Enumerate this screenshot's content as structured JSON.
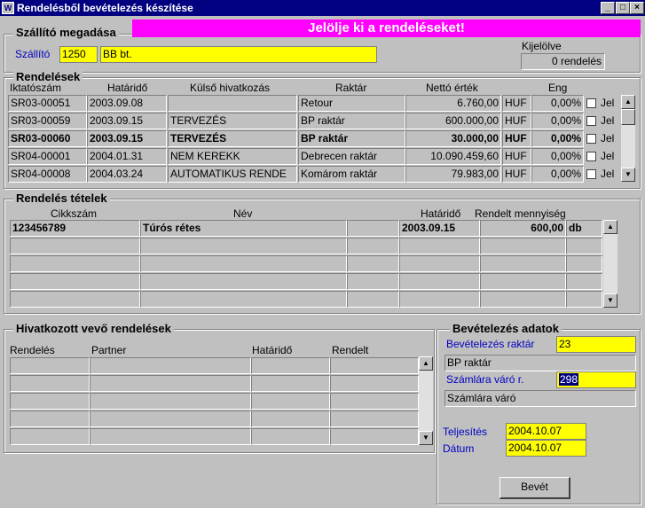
{
  "window": {
    "title": "Rendelésből bevételezés készítése",
    "minimize_glyph": "_",
    "restore_glyph": "□",
    "close_glyph": "×"
  },
  "banner": "Jelölje ki a rendeléseket!",
  "supplier": {
    "group_title": "Szállító megadása",
    "label": "Szállító",
    "code": "1250",
    "name": "BB bt.",
    "selected_label": "Kijelölve",
    "selected_value": "0 rendelés"
  },
  "orders": {
    "group_title": "Rendelések",
    "headers": [
      "Iktatószám",
      "Határidő",
      "Külső hivatkozás",
      "Raktár",
      "Nettó érték",
      "Eng"
    ],
    "rows": [
      {
        "id": "SR03-00051",
        "date": "2003.09.08",
        "ref": "",
        "warehouse": "Retour",
        "net": "6.760,00",
        "cur": "HUF",
        "disc": "0,00%",
        "jel": "Jel",
        "bold": false
      },
      {
        "id": "SR03-00059",
        "date": "2003.09.15",
        "ref": "TERVEZÉS",
        "warehouse": "BP raktár",
        "net": "600.000,00",
        "cur": "HUF",
        "disc": "0,00%",
        "jel": "Jel",
        "bold": false
      },
      {
        "id": "SR03-00060",
        "date": "2003.09.15",
        "ref": "TERVEZÉS",
        "warehouse": "BP raktár",
        "net": "30.000,00",
        "cur": "HUF",
        "disc": "0,00%",
        "jel": "Jel",
        "bold": true
      },
      {
        "id": "SR04-00001",
        "date": "2004.01.31",
        "ref": "NEM KEREKK",
        "warehouse": "Debrecen raktár",
        "net": "10.090.459,60",
        "cur": "HUF",
        "disc": "0,00%",
        "jel": "Jel",
        "bold": false
      },
      {
        "id": "SR04-00008",
        "date": "2004.03.24",
        "ref": "AUTOMATIKUS RENDE",
        "warehouse": "Komárom raktár",
        "net": "79.983,00",
        "cur": "HUF",
        "disc": "0,00%",
        "jel": "Jel",
        "bold": false
      }
    ]
  },
  "items": {
    "group_title": "Rendelés tételek",
    "headers": [
      "Cikkszám",
      "Név",
      "Határidő",
      "Rendelt mennyiség"
    ],
    "rows": [
      {
        "code": "123456789",
        "name": "Túrós rétes",
        "extra": "",
        "date": "2003.09.15",
        "qty": "600,00",
        "unit": "db"
      }
    ]
  },
  "referenced": {
    "group_title": "Hivatkozott vevő rendelések",
    "headers": [
      "Rendelés",
      "Partner",
      "Határidő",
      "Rendelt"
    ]
  },
  "receipt": {
    "group_title": "Bevételezés adatok",
    "warehouse_label": "Bevételezés raktár",
    "warehouse_code": "23",
    "warehouse_name": "BP raktár",
    "invoice_label": "Számlára váró r.",
    "invoice_code": "298",
    "invoice_name": "Számlára váró",
    "completion_label": "Teljesítés",
    "completion_date": "2004.10.07",
    "date_label": "Dátum",
    "date_value": "2004.10.07",
    "submit_label": "Bevét"
  }
}
